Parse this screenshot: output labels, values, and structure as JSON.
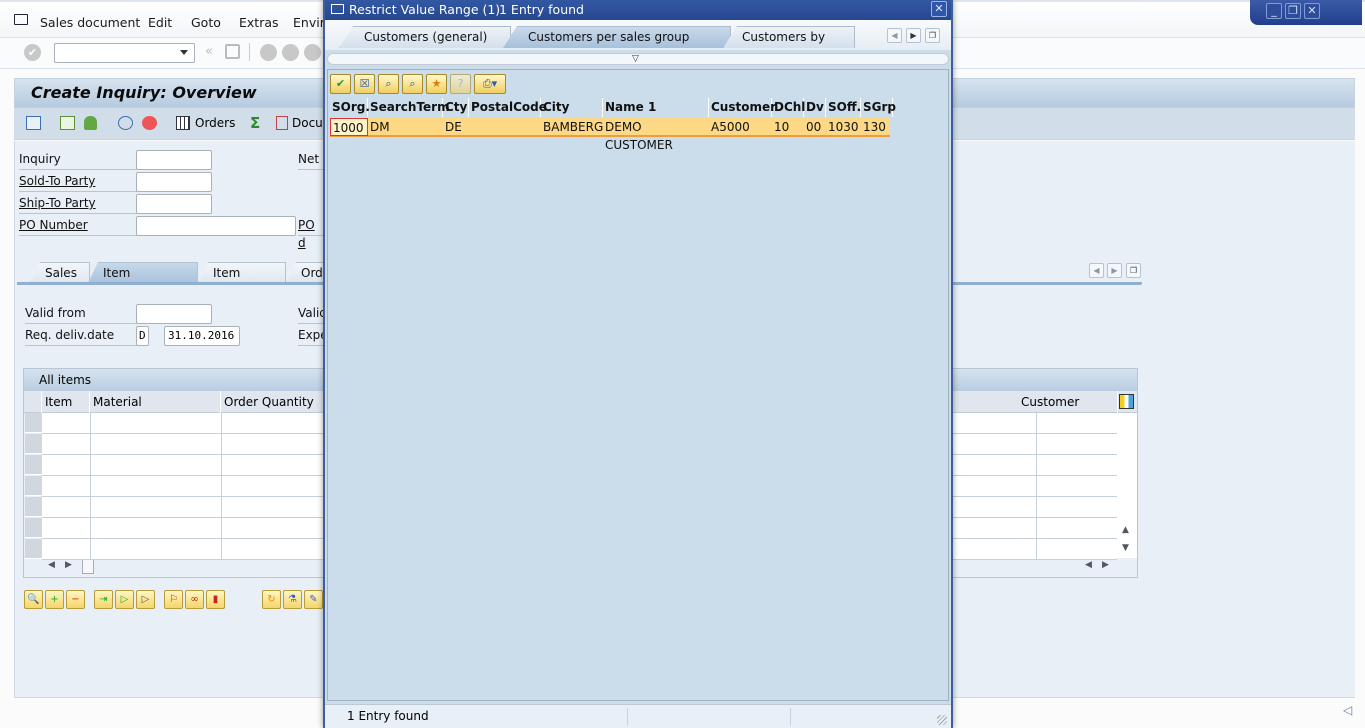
{
  "menubar": {
    "items": [
      "Sales document",
      "Edit",
      "Goto",
      "Extras",
      "Enviro"
    ]
  },
  "window_controls": {
    "minimize": "_",
    "restore": "❐",
    "close": "✕"
  },
  "toolbar": {
    "enter_icon": "✔",
    "command_value": "",
    "back": "«",
    "save_icon": "save-icon"
  },
  "main": {
    "title": "Create Inquiry: Overview",
    "app_toolbar": {
      "orders": "Orders",
      "documents": "Docu"
    },
    "header_fields": [
      {
        "label": "Inquiry",
        "value": "",
        "link": false
      },
      {
        "label": "Sold-To Party",
        "value": "",
        "link": true
      },
      {
        "label": "Ship-To Party",
        "value": "",
        "link": true
      },
      {
        "label": "PO Number",
        "value": "",
        "link": true
      }
    ],
    "right_labels": [
      "Net",
      "PO d"
    ],
    "tabs": [
      "Sales",
      "Item overview",
      "Item detail",
      "Orde"
    ],
    "active_tab": "Item overview",
    "item_fields": {
      "valid_from_label": "Valid from",
      "valid_from_value": "",
      "req_deliv_label": "Req. deliv.date",
      "req_deliv_unit": "D",
      "req_deliv_value": "31.10.2016",
      "valid_to_label": "Valid",
      "expected_label": "Expe"
    },
    "items_table": {
      "title": "All items",
      "columns": [
        "Item",
        "Material",
        "Order Quantity",
        "Customer Material"
      ],
      "rows": 7
    }
  },
  "dialog": {
    "title": "Restrict Value Range (1)",
    "subtitle": "1 Entry found",
    "close": "✕",
    "tabs": [
      "Customers (general)",
      "Customers per sales group",
      "Customers by Add..."
    ],
    "active_tab": "Customers per sales group",
    "columns": [
      "SOrg.",
      "SearchTerm",
      "Cty",
      "PostalCode",
      "City",
      "Name 1",
      "Customer",
      "DChl",
      "Dv",
      "SOff.",
      "SGrp"
    ],
    "rows": [
      [
        "1000",
        "DM",
        "DE",
        "",
        "BAMBERG",
        "DEMO CUSTOMER",
        "A5000",
        "10",
        "00",
        "1030",
        "130"
      ]
    ],
    "status": "1 Entry found"
  }
}
